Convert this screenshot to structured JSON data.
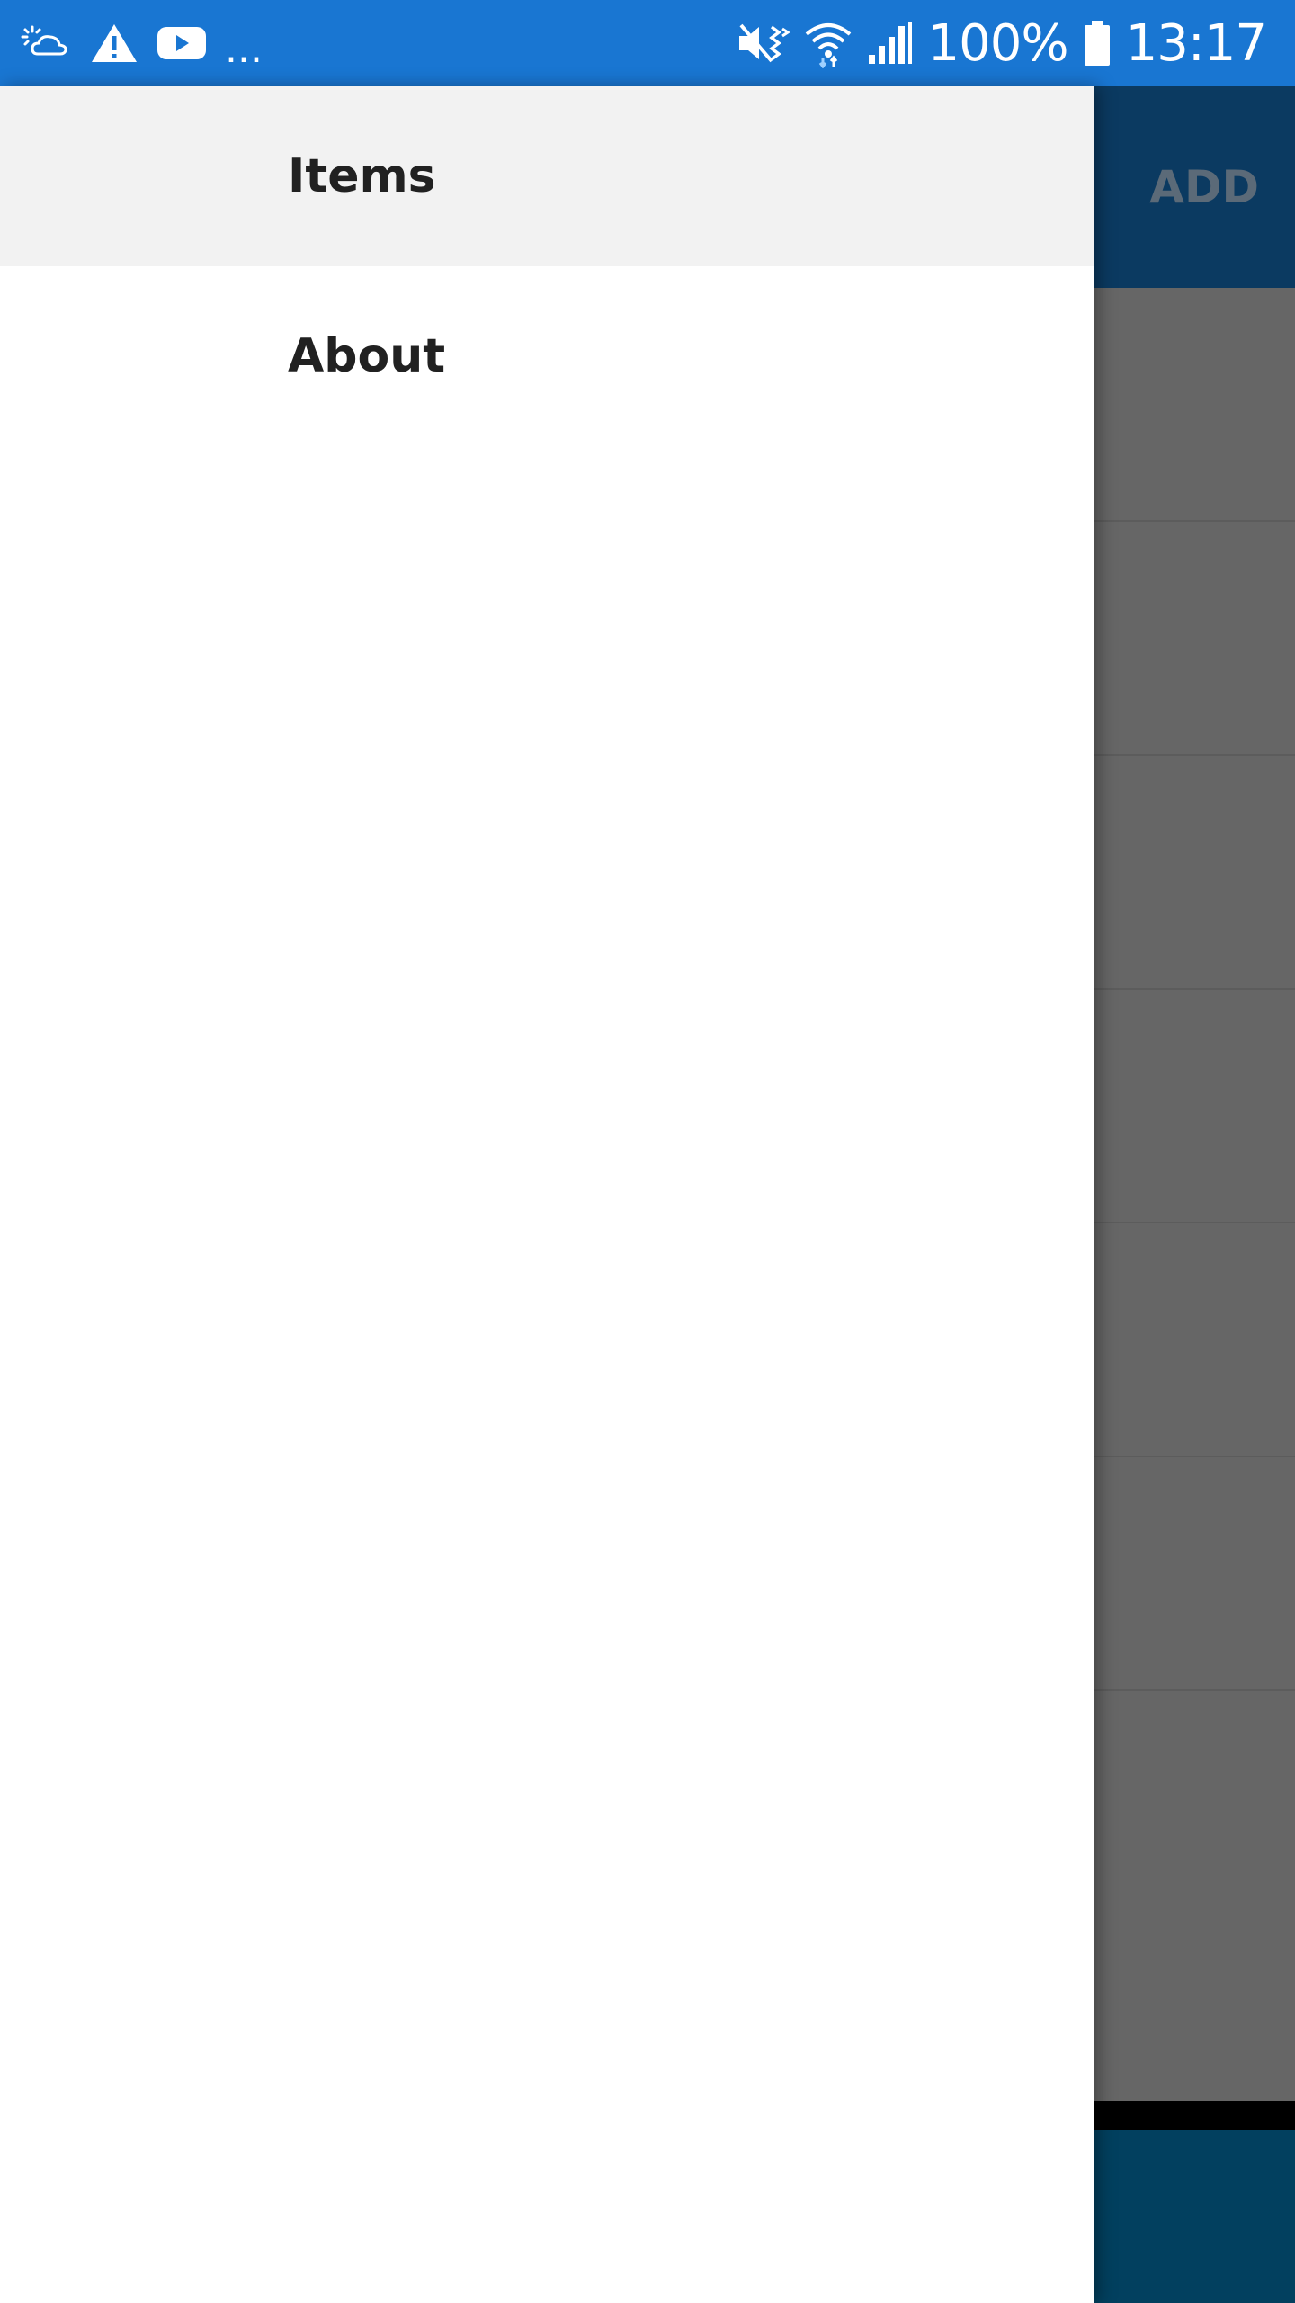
{
  "status_bar": {
    "battery_percent": "100%",
    "time": "13:17",
    "overflow": "...",
    "left_icons": [
      "weather-icon",
      "warning-icon",
      "youtube-icon"
    ],
    "right_icons": [
      "mute-vibrate-icon",
      "wifi-icon",
      "signal-icon",
      "battery-icon"
    ]
  },
  "toolbar": {
    "add_label": "ADD"
  },
  "drawer": {
    "items": [
      {
        "label": "Items",
        "selected": true
      },
      {
        "label": "About",
        "selected": false
      }
    ]
  },
  "colors": {
    "status_bar": "#1976D2",
    "toolbar_dimmed": "#0B3A61",
    "bottom_bar_dimmed": "#02405F",
    "selected_item_bg": "#F2F2F2"
  }
}
